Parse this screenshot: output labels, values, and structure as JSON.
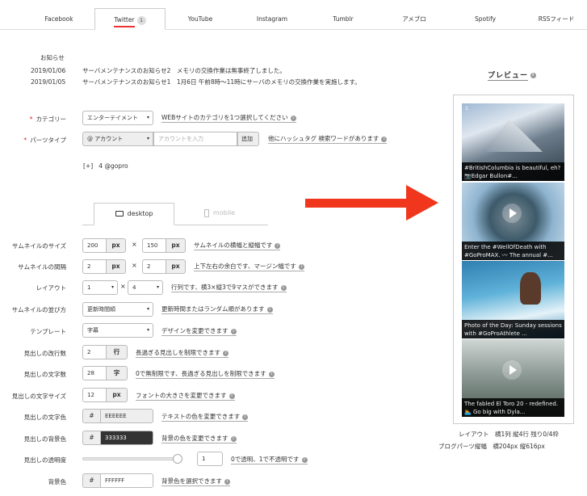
{
  "tabs": [
    {
      "label": "Facebook"
    },
    {
      "label": "Twitter",
      "badge": "1"
    },
    {
      "label": "YouTube"
    },
    {
      "label": "Instagram"
    },
    {
      "label": "Tumblr"
    },
    {
      "label": "アメブロ"
    },
    {
      "label": "Spotify"
    },
    {
      "label": "RSSフィード"
    }
  ],
  "news": {
    "title": "お知らせ",
    "items": [
      {
        "date": "2019/01/06",
        "text": "サーバメンテナンスのお知らせ2　メモリの交換作業は無事終了しました。"
      },
      {
        "date": "2019/01/05",
        "text": "サーバメンテナンスのお知らせ1　1月6日 午前8時〜11時にサーバのメモリの交換作業を実施します。"
      }
    ]
  },
  "category": {
    "label": "カテゴリー",
    "value": "エンターテイメント",
    "help": "WEBサイトのカテゴリを1つ選択してください"
  },
  "parts": {
    "label": "パーツタイプ",
    "type": "@ アカウント",
    "placeholder": "アカウントを入力",
    "add": "追加",
    "help": "他にハッシュタグ 検索ワードがあります"
  },
  "account": {
    "toggle": "[+]",
    "entry": "4  @gopro"
  },
  "device_tabs": {
    "desktop": "desktop",
    "mobile": "mobile"
  },
  "settings": {
    "thumb_size": {
      "label": "サムネイルのサイズ",
      "w": "200",
      "h": "150",
      "unit": "px",
      "times": "×",
      "help": "サムネイルの横幅と縦幅です"
    },
    "thumb_gap": {
      "label": "サムネイルの間隔",
      "w": "2",
      "h": "2",
      "unit": "px",
      "times": "×",
      "help": "上下左右の余白です、マージン幅です"
    },
    "layout": {
      "label": "レイアウト",
      "cols": "1",
      "rows": "4",
      "times": "×",
      "help": "行列です、横3×縦3で9マスができます"
    },
    "order": {
      "label": "サムネイルの並び方",
      "value": "更新時間順",
      "help": "更新時間またはランダム順があります"
    },
    "template": {
      "label": "テンプレート",
      "value": "字幕",
      "help": "デザインを変更できます"
    },
    "line_count": {
      "label": "見出しの改行数",
      "value": "2",
      "unit": "行",
      "help": "長過ぎる見出しを制限できます"
    },
    "char_count": {
      "label": "見出しの文字数",
      "value": "28",
      "unit": "字",
      "help": "0で無制限です、長過ぎる見出しを制限できます"
    },
    "font_size": {
      "label": "見出しの文字サイズ",
      "value": "12",
      "unit": "px",
      "help": "フォントの大きさを変更できます"
    },
    "text_color": {
      "label": "見出しの文字色",
      "prefix": "#",
      "value": "EEEEEE",
      "help": "テキストの色を変更できます"
    },
    "bg_color": {
      "label": "見出しの背景色",
      "prefix": "#",
      "value": "333333",
      "help": "背景の色を変更できます"
    },
    "opacity": {
      "label": "見出しの透明度",
      "value": "1",
      "level": 1,
      "help": "0で透明、1で不透明です"
    },
    "page_bg": {
      "label": "背景色",
      "prefix": "#",
      "value": "FFFFFF",
      "help": "背景色を選択できます"
    }
  },
  "preview": {
    "title": "プレビュー",
    "cards": [
      {
        "caption": "#BritishColumbia is beautiful, eh?📷Edgar Bullon#...",
        "video": false,
        "badge": "1"
      },
      {
        "caption": "Enter the #WellOfDeath with #GoProMAX. 〰 The annual #...",
        "video": true
      },
      {
        "caption": "Photo of the Day: Sunday sessions with #GoProAthlete ...",
        "video": false
      },
      {
        "caption": "The fabled El Toro 20 - redefined. 🏊 Go big with Dyla...",
        "video": true
      }
    ],
    "layout_stat": "レイアウト　横1列 縦4行 残り0/4枠",
    "size_stat": "ブログパーツ縦幅　横204px 縦616px"
  },
  "colors": {
    "accent": "#f0361c",
    "required": "#dd2222"
  }
}
